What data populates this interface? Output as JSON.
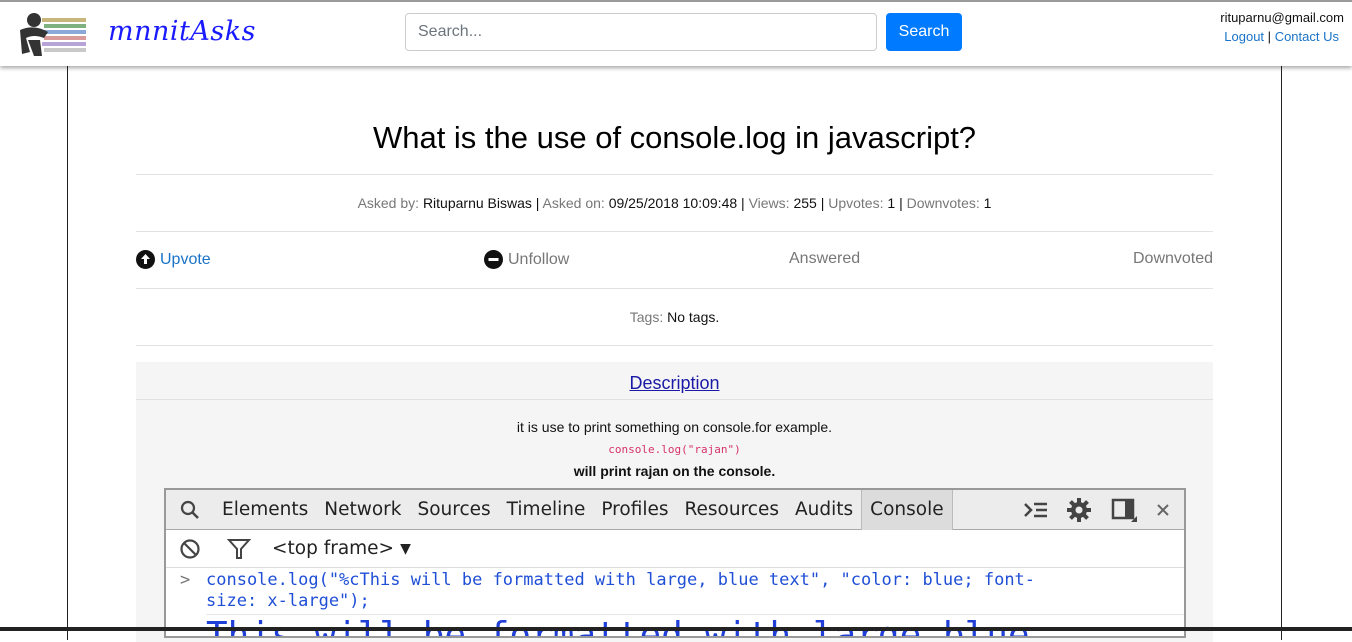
{
  "header": {
    "brand": "mnnitAsks",
    "search_placeholder": "Search...",
    "search_button": "Search",
    "user_email": "rituparnu@gmail.com",
    "logout": "Logout",
    "separator": "|",
    "contact": "Contact Us"
  },
  "question": {
    "title": "What is the use of console.log in javascript?",
    "meta": {
      "asked_by_label": "Asked by:",
      "asked_by": "Rituparnu Biswas",
      "asked_on_label": "Asked on:",
      "asked_on": "09/25/2018 10:09:48",
      "views_label": "Views:",
      "views": "255",
      "upvotes_label": "Upvotes:",
      "upvotes": "1",
      "downvotes_label": "Downvotes:",
      "downvotes": "1",
      "sep": "|"
    },
    "actions": {
      "upvote": "Upvote",
      "unfollow": "Unfollow",
      "answered": "Answered",
      "downvoted": "Downvoted"
    },
    "tags_label": "Tags:",
    "tags_value": "No tags."
  },
  "description": {
    "heading": "Description",
    "line1": "it is use to print something on console.for example.",
    "code": "console.log(\"rajan\")",
    "bold": "will print rajan on the console."
  },
  "devtools": {
    "tabs": [
      "Elements",
      "Network",
      "Sources",
      "Timeline",
      "Profiles",
      "Resources",
      "Audits",
      "Console"
    ],
    "frame": "<top frame>",
    "prompt": ">",
    "code_line1": "console.log(\"%cThis will be formatted with large, blue text\", \"color: blue; font-",
    "code_line2": "size: x-large\");",
    "output": "This will be formatted with large blue"
  },
  "colors": {
    "primary": "#007bff",
    "link": "#1a73c8",
    "code_pink": "#d6336c",
    "console_blue": "#1f4fd6"
  }
}
